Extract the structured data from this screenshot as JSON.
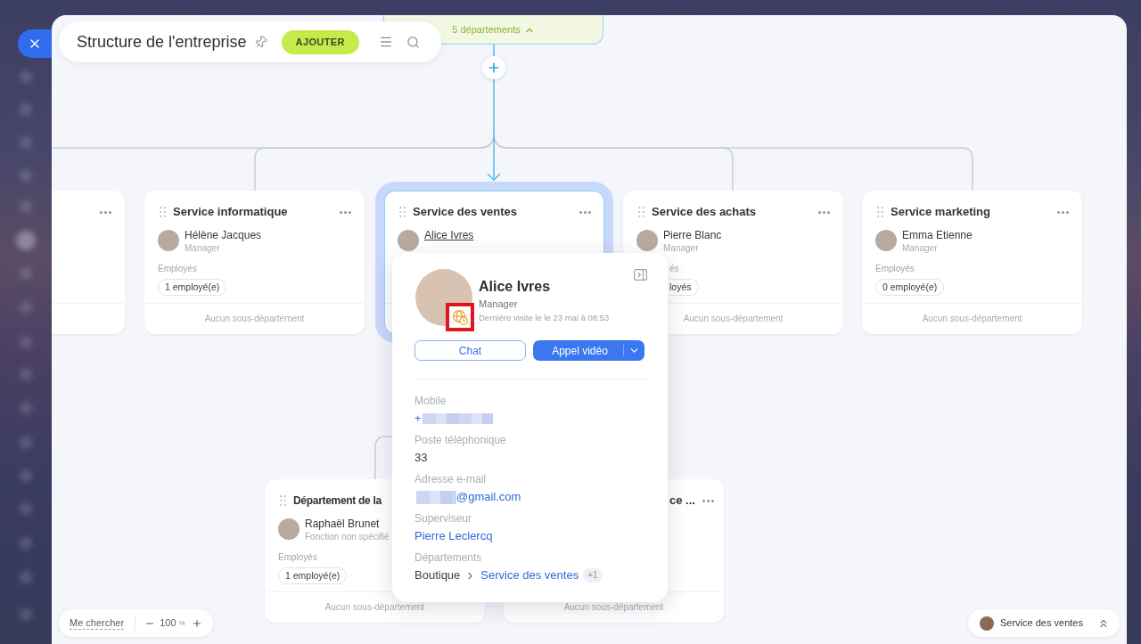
{
  "header": {
    "title": "Structure de l'entreprise",
    "add_button": "AJOUTER"
  },
  "parent_node": {
    "summary": "5 départements",
    "expanded": true
  },
  "departments": [
    {
      "selected": false
    },
    {
      "title": "Service informatique",
      "selected": false,
      "manager": {
        "name": "Hélène Jacques",
        "role": "Manager",
        "hovered": false
      },
      "employees_label": "Employés",
      "employees_count": "1 employé(e)",
      "footer": "Aucun sous-département"
    },
    {
      "title": "Service des ventes",
      "selected": true,
      "manager": {
        "name": "Alice Ivres",
        "hovered": true
      }
    },
    {
      "title": "Service des achats",
      "selected": false,
      "manager": {
        "name": "Pierre Blanc",
        "role": "Manager",
        "hovered": false
      },
      "employees_label": "és",
      "employees_count": "loyés",
      "footer": "Aucun sous-département"
    },
    {
      "title": "Service marketing",
      "selected": false,
      "manager": {
        "name": "Emma Etienne",
        "role": "Manager",
        "hovered": false
      },
      "employees_label": "Employés",
      "employees_count": "0 employé(e)",
      "footer": "Aucun sous-département"
    }
  ],
  "sub_departments": [
    {
      "title": "Département de la",
      "selected": false,
      "manager": {
        "name": "Raphaël Brunet",
        "role": "Fonction non spécifié",
        "hovered": false
      },
      "employees_label": "Employés",
      "employees_count": "1 employé(e)",
      "footer": "Aucun sous-département"
    },
    {
      "title": "ce ...",
      "selected": false,
      "footer": "Aucun sous-département"
    }
  ],
  "profile_popup": {
    "name": "Alice Ivres",
    "role": "Manager",
    "last_seen": "Dernière visite le le 23 mai à 08:53",
    "status_badge": {
      "highlighted": true
    },
    "chat_button": "Chat",
    "call_button": "Appel vidéo",
    "fields": [
      {
        "kind": "phone",
        "label": "Mobile",
        "value": "+"
      },
      {
        "kind": "text",
        "label": "Poste téléphonique",
        "value": "33"
      },
      {
        "kind": "email",
        "label": "Adresse e-mail",
        "value": "@gmail.com"
      },
      {
        "kind": "link",
        "label": "Superviseur",
        "value": "Pierre Leclercq"
      },
      {
        "kind": "path",
        "label": "Départements",
        "path": [
          {
            "label": "Boutique",
            "link": false
          },
          {
            "label": "Service des ventes",
            "link": true
          }
        ],
        "extra": "+1"
      }
    ]
  },
  "zoom_control": {
    "find_me": "Me chercher",
    "level_text": "100",
    "unit": "%"
  },
  "current_department": {
    "label": "Service des ventes"
  }
}
